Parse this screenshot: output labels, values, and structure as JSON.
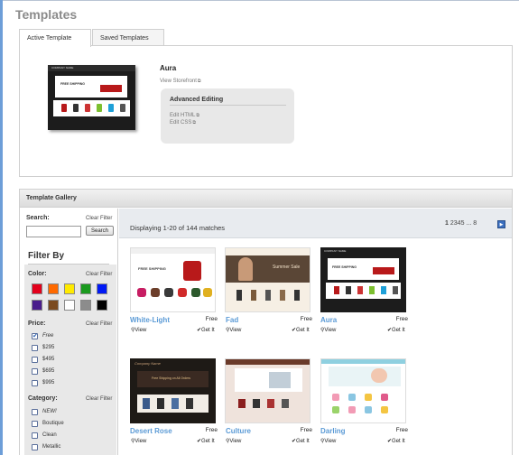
{
  "page_title": "Templates",
  "tabs": [
    "Active Template",
    "Saved Templates"
  ],
  "active_template": {
    "name": "Aura",
    "view_storefront": "View Storefront",
    "advanced_title": "Advanced Editing",
    "edit_html": "Edit HTML",
    "edit_css": "Edit CSS"
  },
  "gallery": {
    "title": "Template Gallery",
    "search_label": "Search:",
    "clear_filter": "Clear Filter",
    "search_button": "Search",
    "filter_by": "Filter By",
    "color_label": "Color:",
    "colors": [
      "#e3001b",
      "#ff6a00",
      "#ffea00",
      "#1a9a1e",
      "#0019f5",
      "#4a1d8c",
      "#7a4a1f",
      "#ffffff",
      "#8c8c8c",
      "#000000"
    ],
    "price_label": "Price:",
    "prices": [
      {
        "label": "Free",
        "checked": true
      },
      {
        "label": "$295",
        "checked": false
      },
      {
        "label": "$495",
        "checked": false
      },
      {
        "label": "$695",
        "checked": false
      },
      {
        "label": "$995",
        "checked": false
      }
    ],
    "category_label": "Category:",
    "categories": [
      {
        "label": "NEW!",
        "checked": false
      },
      {
        "label": "Boutique",
        "checked": false
      },
      {
        "label": "Clean",
        "checked": false
      },
      {
        "label": "Metallic",
        "checked": false
      }
    ],
    "displaying": "Displaying 1-20 of 144 matches",
    "pagination": {
      "current": "1",
      "pages": [
        "2",
        "3",
        "4",
        "5"
      ],
      "ellipsis": "...",
      "last": "8"
    },
    "cards": [
      {
        "name": "White-Light",
        "price": "Free",
        "view": "View",
        "get": "Get It"
      },
      {
        "name": "Fad",
        "price": "Free",
        "view": "View",
        "get": "Get It"
      },
      {
        "name": "Aura",
        "price": "Free",
        "view": "View",
        "get": "Get It"
      },
      {
        "name": "Desert Rose",
        "price": "Free",
        "view": "View",
        "get": "Get It"
      },
      {
        "name": "Culture",
        "price": "Free",
        "view": "View",
        "get": "Get It"
      },
      {
        "name": "Darling",
        "price": "Free",
        "view": "View",
        "get": "Get It"
      }
    ],
    "thumb_text": {
      "company_name": "COMPANY NAME",
      "free_shipping": "FREE SHIPPING",
      "summer_sale": "Summer Sale",
      "desert_company": "Company Name",
      "desert_banner": "Free Shipping on All Orders"
    }
  }
}
